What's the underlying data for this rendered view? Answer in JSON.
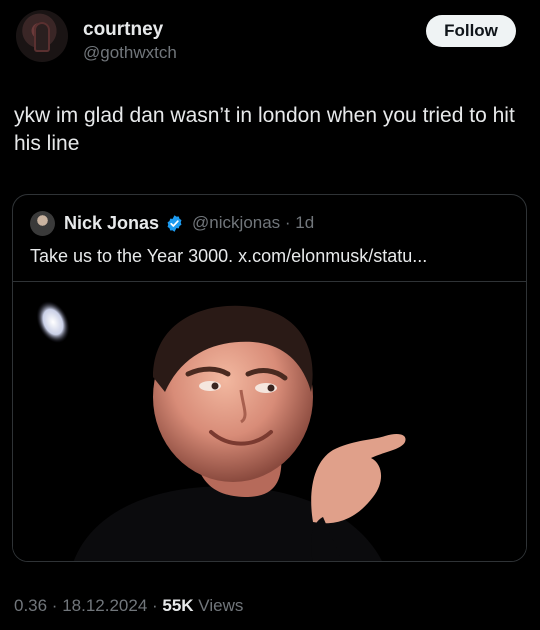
{
  "author": {
    "name": "courtney",
    "handle": "@gothwxtch"
  },
  "follow_label": "Follow",
  "tweet_text": "ykw im glad dan wasn’t in london when you tried to hit his line",
  "quoted": {
    "name": "Nick Jonas",
    "handle_time": "@nickjonas · 1d",
    "text": "Take us to the Year 3000. x.com/elonmusk/statu..."
  },
  "meta": {
    "time_date": "0.36 · 18.12.2024 · ",
    "views_count": "55K",
    "views_label": " Views"
  },
  "colors": {
    "background": "#000000",
    "text_primary": "#e7e9ea",
    "text_secondary": "#71767b",
    "verified": "#1d9bf0",
    "border": "#2f3336"
  }
}
